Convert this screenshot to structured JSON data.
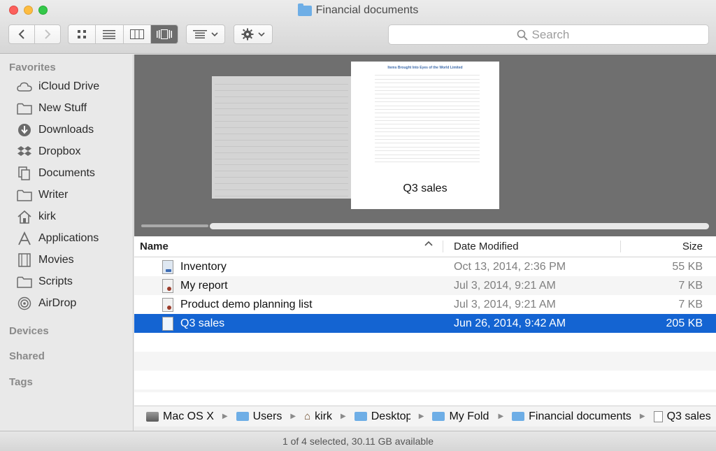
{
  "window": {
    "title": "Financial documents"
  },
  "toolbar": {
    "back_icon": "chevron-left-icon",
    "forward_icon": "chevron-right-icon",
    "view_modes": [
      "icon",
      "list",
      "column",
      "cover-flow"
    ],
    "active_view": "cover-flow",
    "arrange_icon": "arrange-icon",
    "action_icon": "gear-icon",
    "search_placeholder": "Search"
  },
  "sidebar": {
    "favorites_heading": "Favorites",
    "items": [
      {
        "label": "iCloud Drive",
        "icon": "cloud-icon"
      },
      {
        "label": "New Stuff",
        "icon": "folder-icon"
      },
      {
        "label": "Downloads",
        "icon": "download-icon"
      },
      {
        "label": "Dropbox",
        "icon": "dropbox-icon"
      },
      {
        "label": "Documents",
        "icon": "documents-icon"
      },
      {
        "label": "Writer",
        "icon": "folder-icon"
      },
      {
        "label": "kirk",
        "icon": "home-icon"
      },
      {
        "label": "Applications",
        "icon": "applications-icon"
      },
      {
        "label": "Movies",
        "icon": "film-icon"
      },
      {
        "label": "Scripts",
        "icon": "folder-icon"
      },
      {
        "label": "AirDrop",
        "icon": "airdrop-icon"
      }
    ],
    "devices_heading": "Devices",
    "shared_heading": "Shared",
    "tags_heading": "Tags"
  },
  "preview": {
    "sheet_label": "Q3 sales",
    "sheet_title": "Items Brought Into Eyes of the World Limited"
  },
  "list": {
    "columns": {
      "name": "Name",
      "date": "Date Modified",
      "size": "Size"
    },
    "rows": [
      {
        "name": "Inventory",
        "date": "Oct 13, 2014, 2:36 PM",
        "size": "55 KB",
        "selected": false
      },
      {
        "name": "My report",
        "date": "Jul 3, 2014, 9:21 AM",
        "size": "7 KB",
        "selected": false
      },
      {
        "name": "Product demo planning list",
        "date": "Jul 3, 2014, 9:21 AM",
        "size": "7 KB",
        "selected": false
      },
      {
        "name": "Q3 sales",
        "date": "Jun 26, 2014, 9:42 AM",
        "size": "205 KB",
        "selected": true
      }
    ]
  },
  "pathbar": {
    "crumbs": [
      "Mac OS X",
      "Users",
      "kirk",
      "Desktop",
      "My Folder",
      "Financial documents",
      "Q3 sales"
    ]
  },
  "status": {
    "text": "1 of 4 selected, 30.11 GB available"
  },
  "colors": {
    "selection": "#1464d2",
    "folder": "#6eaee6",
    "preview_bg": "#6f6f6f"
  }
}
